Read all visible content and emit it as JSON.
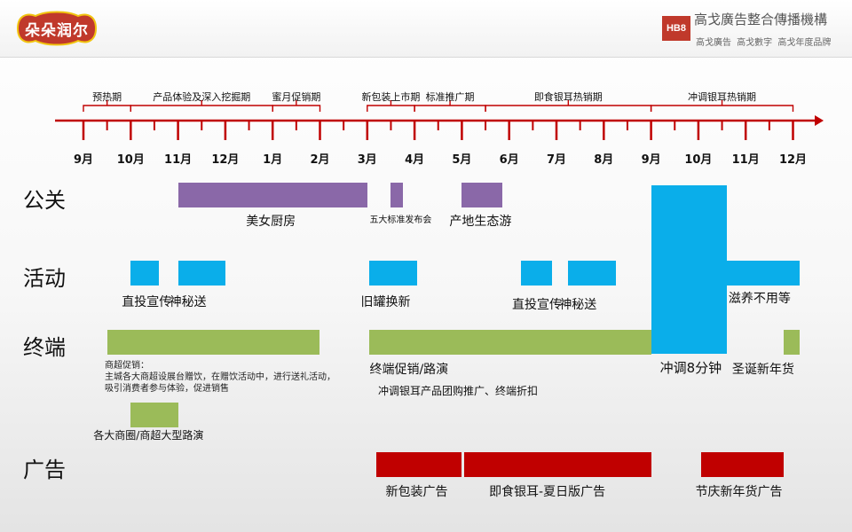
{
  "header": {
    "logo_text": "朵朵润尔",
    "brand_abbr": "HB8",
    "brand_name": "高戈廣告整合傳播機構",
    "brand_tags": "高戈廣告 高戈數字 高戈年度品牌"
  },
  "colors": {
    "purple": "#8a68a8",
    "blue": "#0aaeea",
    "green": "#9bbb59",
    "red": "#c00000",
    "axis": "#c00000"
  },
  "chart_data": {
    "type": "gantt",
    "months": [
      "9月",
      "10月",
      "11月",
      "12月",
      "1月",
      "2月",
      "3月",
      "4月",
      "5月",
      "6月",
      "7月",
      "8月",
      "9月",
      "10月",
      "11月",
      "12月"
    ],
    "phases": [
      {
        "label": "预热期",
        "start": 0,
        "end": 1
      },
      {
        "label": "产品体验及深入挖掘期",
        "start": 1,
        "end": 4
      },
      {
        "label": "蜜月促销期",
        "start": 4,
        "end": 5
      },
      {
        "label": "新包装上市期",
        "start": 6,
        "end": 7
      },
      {
        "label": "标准推广期",
        "start": 7,
        "end": 8.5
      },
      {
        "label": "即食银耳热销期",
        "start": 8.5,
        "end": 12
      },
      {
        "label": "冲调银耳热销期",
        "start": 12,
        "end": 15
      }
    ],
    "rows": [
      {
        "key": "pr",
        "label": "公关",
        "color": "purple",
        "items": [
          {
            "label": "美女厨房",
            "start": 2,
            "end": 6
          },
          {
            "label": "五大标准发布会",
            "start": 6.5,
            "end": 6.75,
            "small": true
          },
          {
            "label": "产地生态游",
            "start": 8,
            "end": 8.85
          }
        ]
      },
      {
        "key": "events",
        "label": "活动",
        "color": "blue",
        "items": [
          {
            "label": "直投宣传",
            "start": 1,
            "end": 1.6
          },
          {
            "label": "神秘送",
            "start": 2,
            "end": 3
          },
          {
            "label": "旧罐换新",
            "start": 6.05,
            "end": 7.05
          },
          {
            "label": "直投宣传",
            "start": 9.25,
            "end": 9.9
          },
          {
            "label": "神秘送",
            "start": 10.25,
            "end": 11.25
          },
          {
            "label": "滋养不用等",
            "start": 13.6,
            "end": 15.15
          }
        ]
      },
      {
        "key": "terminal",
        "label": "终端",
        "color": "green",
        "items": [
          {
            "label": "商超促销",
            "start": 0.5,
            "end": 5
          },
          {
            "label": "各大商圈/商超大型路演",
            "start": 1,
            "end": 2
          },
          {
            "label": "终端促销/路演",
            "start": 6.05,
            "end": 12
          },
          {
            "label": "圣诞新年货",
            "start": 14.8,
            "end": 15.15
          }
        ]
      },
      {
        "key": "ads",
        "label": "广告",
        "color": "red",
        "items": [
          {
            "label": "新包装广告",
            "start": 6.2,
            "end": 8
          },
          {
            "label": "即食银耳-夏日版广告",
            "start": 8.05,
            "end": 12
          },
          {
            "label": "节庆新年货广告",
            "start": 13.05,
            "end": 14.8
          }
        ]
      }
    ],
    "special": {
      "label": "冲调8分钟",
      "start": 12,
      "end": 13.6,
      "color": "blue"
    },
    "notes": {
      "supermarket": "商超促销：\n主城各大商超设展台赠饮，在赠饮活动中，进行送礼活动，吸引消费者参与体验，促进销售",
      "group_buy": "冲调银耳产品团购推广、终端折扣"
    }
  }
}
